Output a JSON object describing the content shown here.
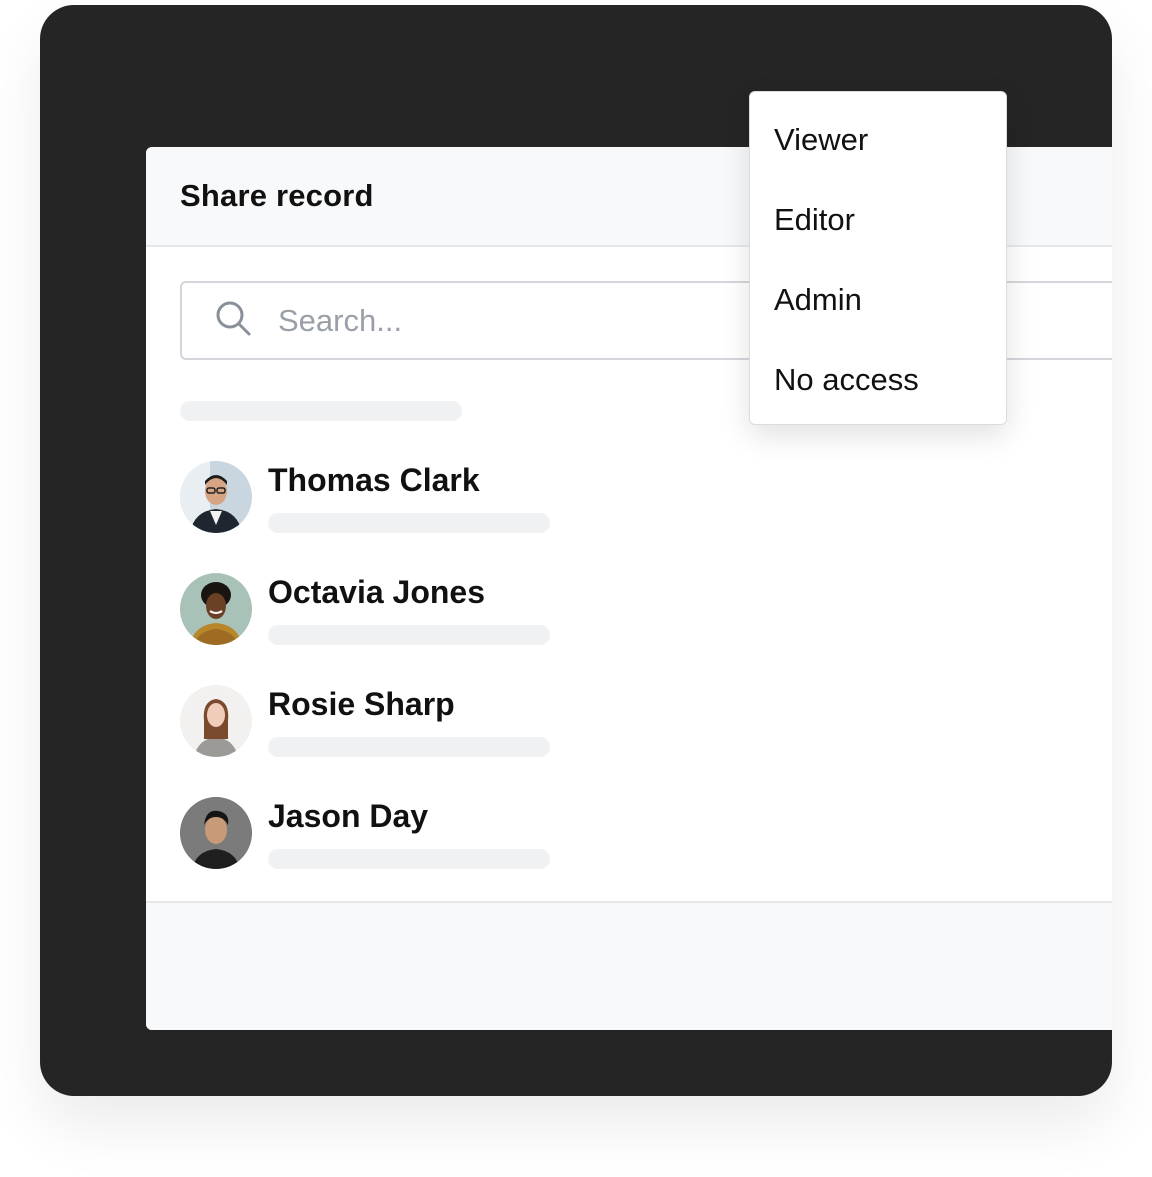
{
  "modal": {
    "title": "Share record"
  },
  "search": {
    "placeholder": "Search...",
    "value": ""
  },
  "people": [
    {
      "name": "Thomas Clark",
      "avatar": "avatar-photo-thomas-clark"
    },
    {
      "name": "Octavia Jones",
      "avatar": "avatar-photo-octavia-jones"
    },
    {
      "name": "Rosie Sharp",
      "avatar": "avatar-photo-rosie-sharp"
    },
    {
      "name": "Jason Day",
      "avatar": "avatar-photo-jason-day"
    }
  ],
  "dropdown": {
    "items": [
      "Viewer",
      "Editor",
      "Admin",
      "No access"
    ]
  },
  "icons": {
    "search": "search-icon"
  },
  "colors": {
    "backdrop": "#252525",
    "header_bg": "#f8f9fa",
    "border": "#d3d6da",
    "skeleton": "#f0f1f3",
    "placeholder": "#9aa0a8"
  }
}
